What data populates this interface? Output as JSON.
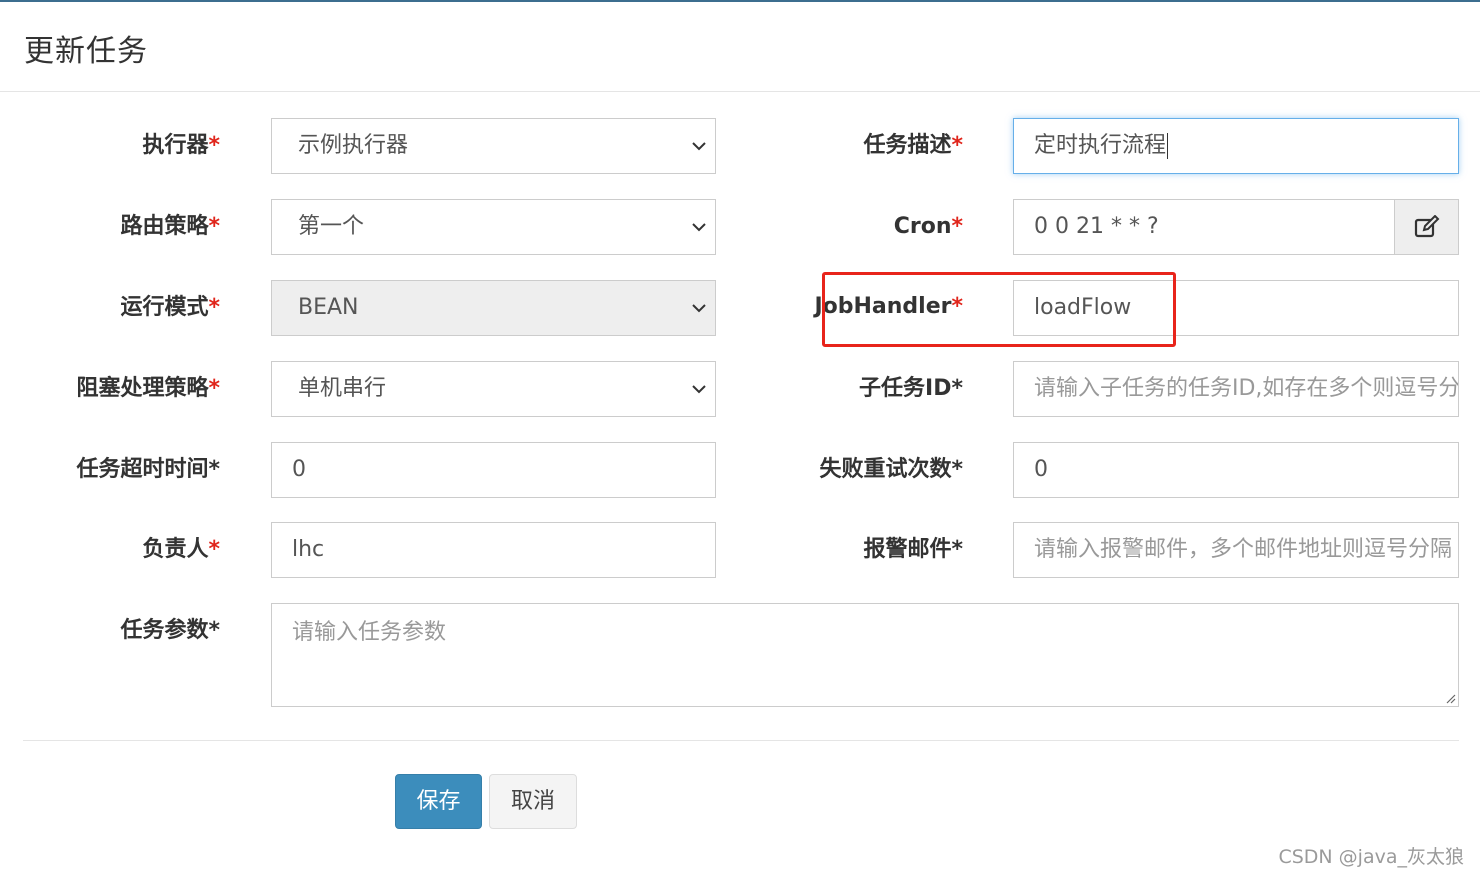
{
  "modal": {
    "title": "更新任务"
  },
  "form": {
    "executor": {
      "label": "执行器",
      "value": "示例执行器"
    },
    "job_desc": {
      "label": "任务描述",
      "value": "定时执行流程"
    },
    "route_strategy": {
      "label": "路由策略",
      "value": "第一个"
    },
    "cron": {
      "label": "Cron",
      "value": "0 0 21 * * ?"
    },
    "run_mode": {
      "label": "运行模式",
      "value": "BEAN"
    },
    "job_handler": {
      "label": "JobHandler",
      "value": "loadFlow"
    },
    "block_strategy": {
      "label": "阻塞处理策略",
      "value": "单机串行"
    },
    "child_job_id": {
      "label": "子任务ID",
      "placeholder": "请输入子任务的任务ID,如存在多个则逗号分隔"
    },
    "timeout": {
      "label": "任务超时时间",
      "value": "0"
    },
    "fail_retry": {
      "label": "失败重试次数",
      "value": "0"
    },
    "author": {
      "label": "负责人",
      "value": "lhc"
    },
    "alarm_email": {
      "label": "报警邮件",
      "placeholder": "请输入报警邮件，多个邮件地址则逗号分隔"
    },
    "job_param": {
      "label": "任务参数",
      "placeholder": "请输入任务参数"
    },
    "required_mark": "*"
  },
  "buttons": {
    "save": "保存",
    "cancel": "取消"
  },
  "watermark": "CSDN @java_灰太狼",
  "colors": {
    "primary": "#3c8dbc",
    "required": "#e0251b",
    "highlight": "#e8241b"
  },
  "icons": {
    "cron_edit": "edit-icon",
    "select_arrow": "chevron-down-icon"
  }
}
